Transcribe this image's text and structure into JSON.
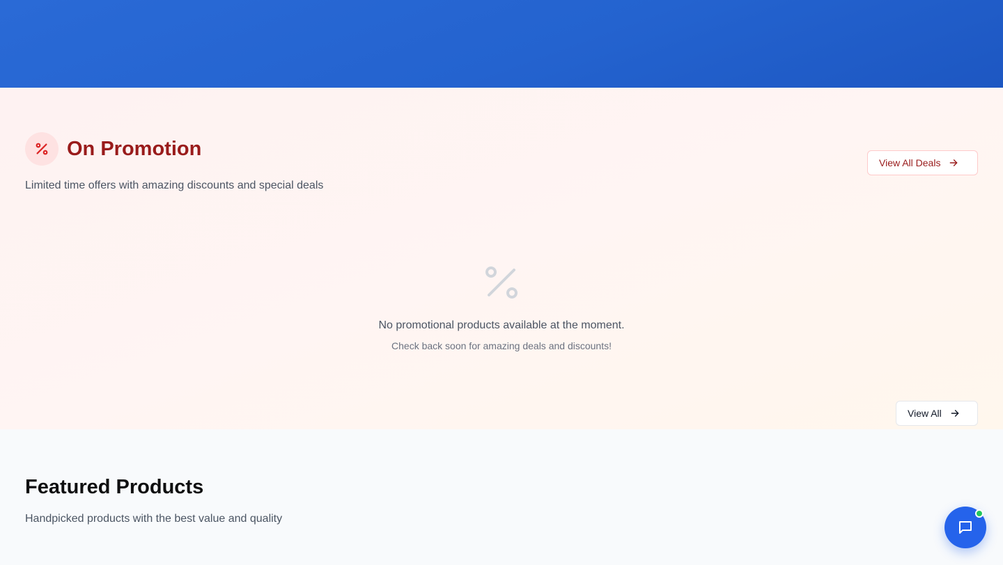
{
  "promotion": {
    "icon": "percent-icon",
    "title": "On Promotion",
    "subtitle": "Limited time offers with amazing discounts and special deals",
    "view_all_label": "View All Deals",
    "empty_icon": "percent-icon",
    "empty_title": "No promotional products available at the moment.",
    "empty_subtitle": "Check back soon for amazing deals and discounts!",
    "accent_color": "#991b1b"
  },
  "featured": {
    "title": "Featured Products",
    "subtitle": "Handpicked products with the best value and quality",
    "view_all_label": "View All"
  },
  "chat": {
    "icon": "chat-bubble-icon",
    "status": "online",
    "status_color": "#22c55e",
    "button_color": "#2563eb"
  },
  "hero": {
    "background_color": "#2463cf"
  }
}
